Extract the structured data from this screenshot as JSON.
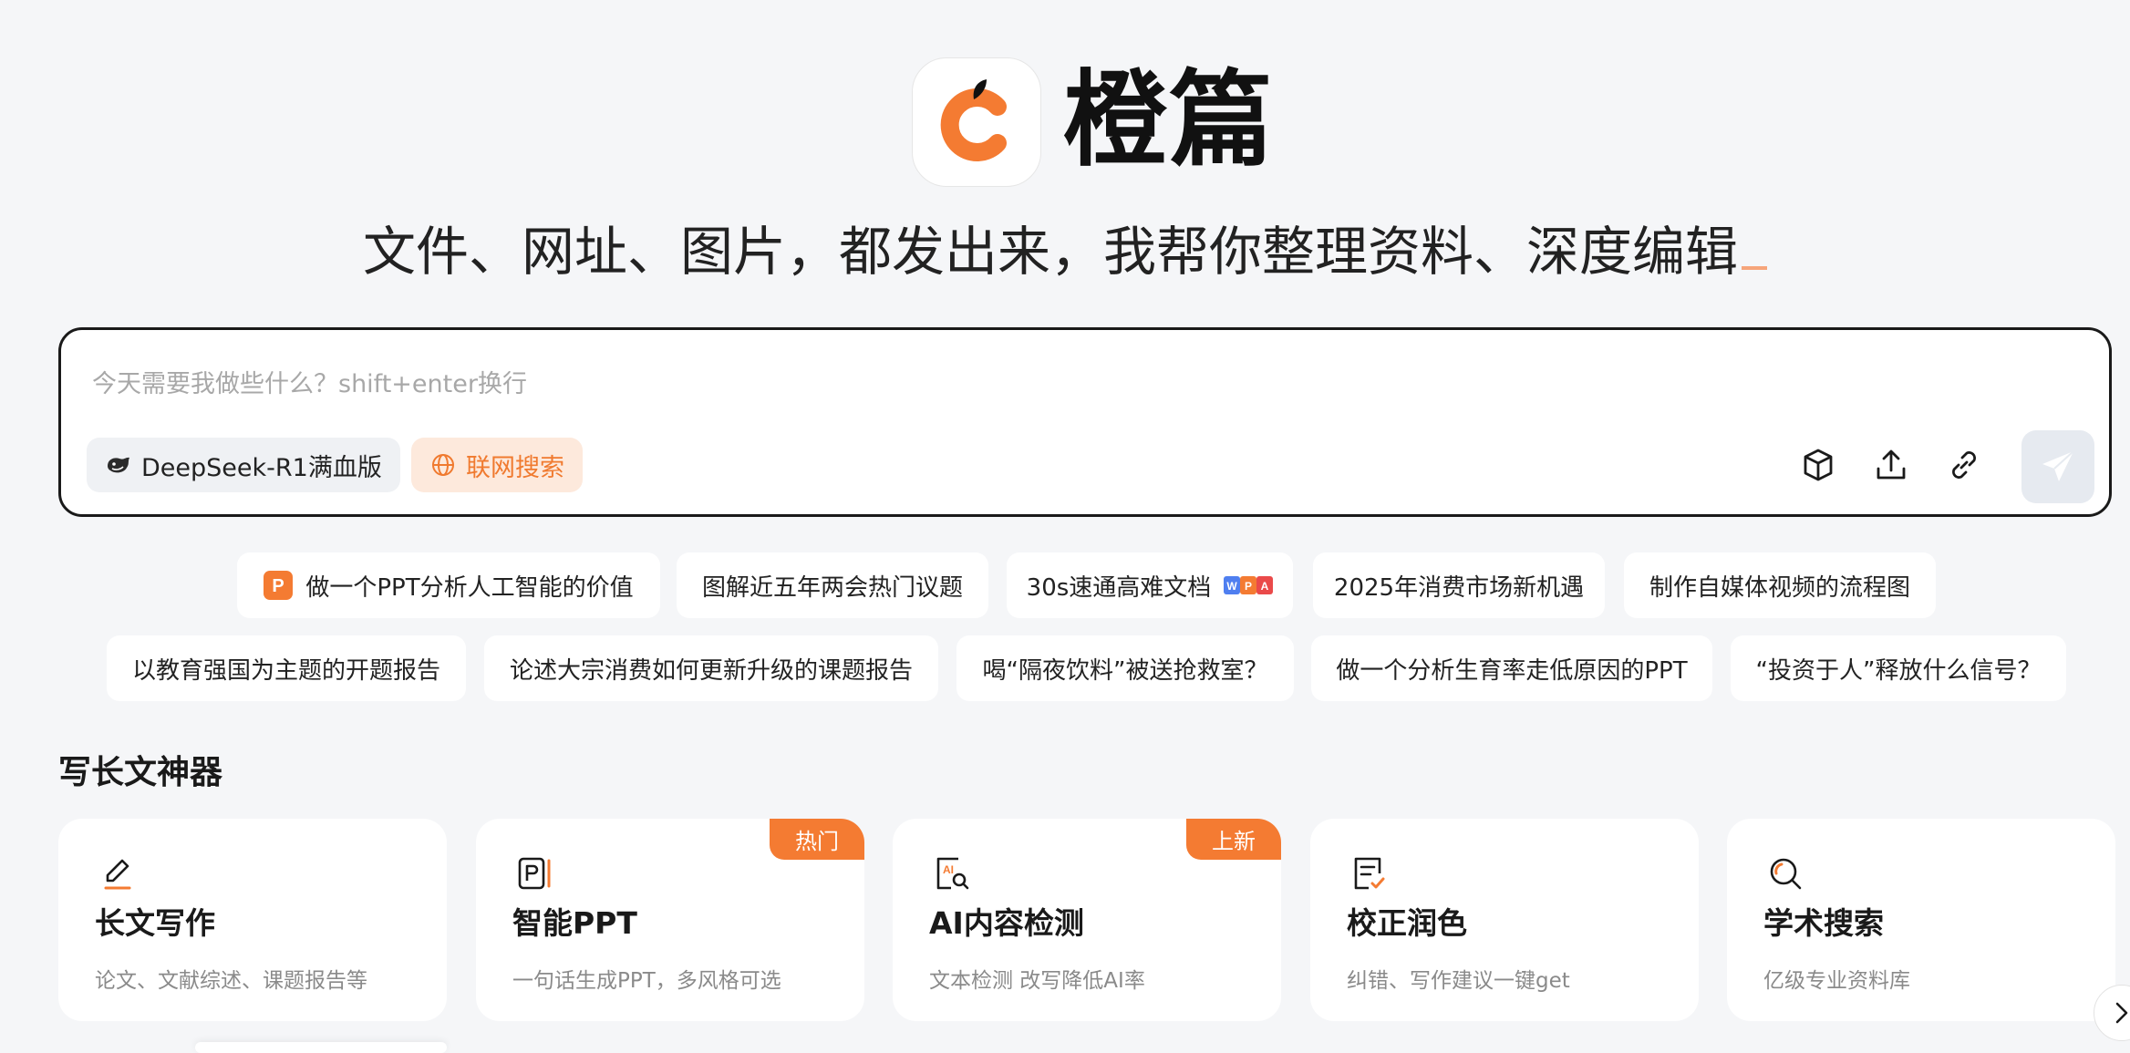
{
  "brand": {
    "name": "橙篇",
    "accent": "#F47B32"
  },
  "tagline": "文件、网址、图片，都发出来，我帮你整理资料、深度编辑",
  "prompt": {
    "placeholder": "今天需要我做些什么？shift+enter换行",
    "value": "",
    "model_chip": "DeepSeek-R1满血版",
    "web_chip": "联网搜索"
  },
  "suggestions_row1": [
    "做一个PPT分析人工智能的价值",
    "图解近五年两会热门议题",
    "30s速通高难文档",
    "2025年消费市场新机遇",
    "制作自媒体视频的流程图"
  ],
  "suggestions_row2": [
    "以教育强国为主题的开题报告",
    "论述大宗消费如何更新升级的课题报告",
    "喝“隔夜饮料”被送抢救室？",
    "做一个分析生育率走低原因的PPT",
    "“投资于人”释放什么信号？"
  ],
  "section": {
    "title": "写长文神器",
    "cards": [
      {
        "title": "长文写作",
        "desc": "论文、文献综述、课题报告等",
        "badge": "",
        "icon": "pen-icon"
      },
      {
        "title": "智能PPT",
        "desc": "一句话生成PPT，多风格可选",
        "badge": "热门",
        "icon": "ppt-icon"
      },
      {
        "title": "AI内容检测",
        "desc": "文本检测 改写降低AI率",
        "badge": "上新",
        "icon": "ai-detect-icon"
      },
      {
        "title": "校正润色",
        "desc": "纠错、写作建议一键get",
        "badge": "",
        "icon": "proofread-icon"
      },
      {
        "title": "学术搜索",
        "desc": "亿级专业资料库",
        "badge": "",
        "icon": "search-icon"
      }
    ]
  }
}
